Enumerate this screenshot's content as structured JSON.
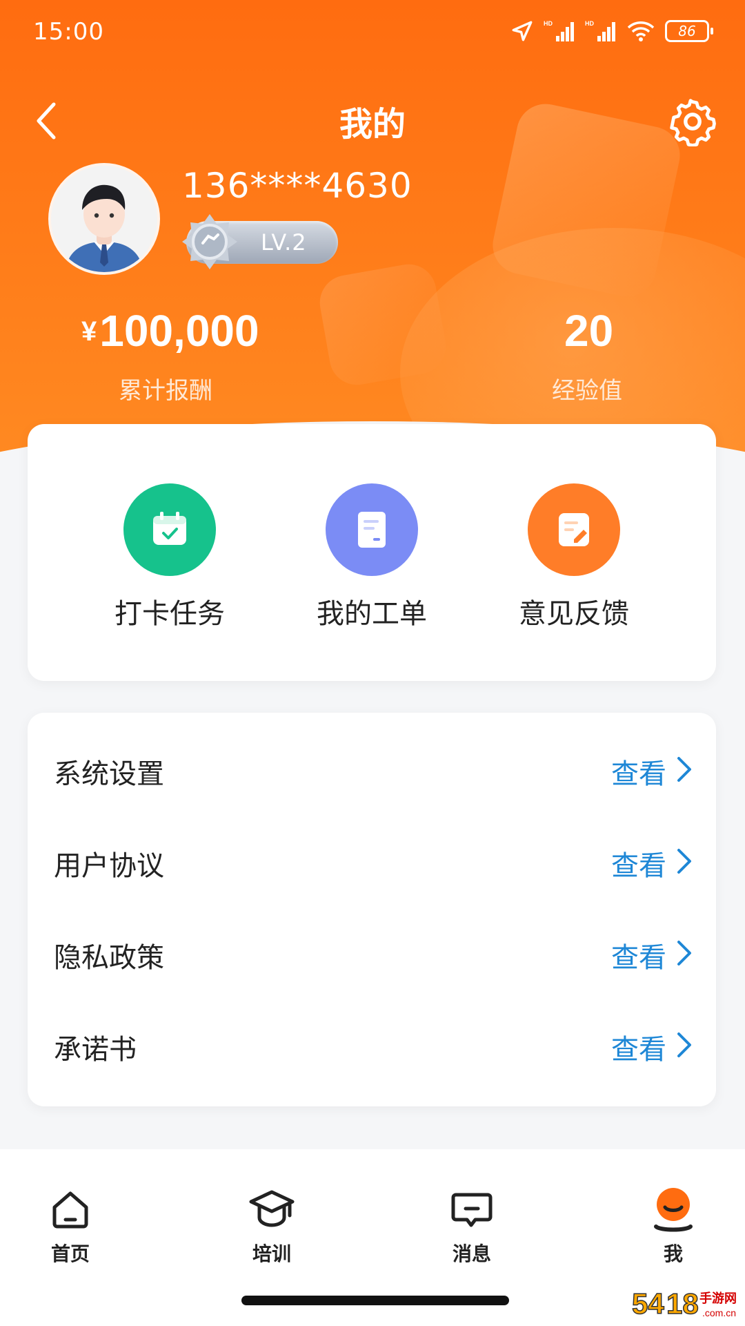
{
  "status_bar": {
    "time": "15:00",
    "battery": "86"
  },
  "nav": {
    "title": "我的",
    "back_icon": "chevron-left-icon",
    "settings_icon": "gear-icon"
  },
  "profile": {
    "phone": "136****4630",
    "level": "LV.2"
  },
  "stats": {
    "currency": "¥",
    "reward_value": "100,000",
    "reward_label": "累计报酬",
    "exp_value": "20",
    "exp_label": "经验值"
  },
  "quick_actions": [
    {
      "label": "打卡任务",
      "icon": "calendar-check-icon",
      "color": "#16c28c"
    },
    {
      "label": "我的工单",
      "icon": "document-icon",
      "color": "#7b8cf5"
    },
    {
      "label": "意见反馈",
      "icon": "edit-note-icon",
      "color": "#ff7d28"
    }
  ],
  "settings_list": [
    {
      "label": "系统设置",
      "link": "查看"
    },
    {
      "label": "用户协议",
      "link": "查看"
    },
    {
      "label": "隐私政策",
      "link": "查看"
    },
    {
      "label": "承诺书",
      "link": "查看"
    }
  ],
  "tabbar": [
    {
      "label": "首页",
      "icon": "home-icon"
    },
    {
      "label": "培训",
      "icon": "graduation-cap-icon"
    },
    {
      "label": "消息",
      "icon": "message-icon"
    },
    {
      "label": "我",
      "icon": "user-icon",
      "active": true
    }
  ],
  "colors": {
    "brand": "#ff6c10",
    "link": "#1e87d6"
  },
  "watermark": "5418手游网"
}
